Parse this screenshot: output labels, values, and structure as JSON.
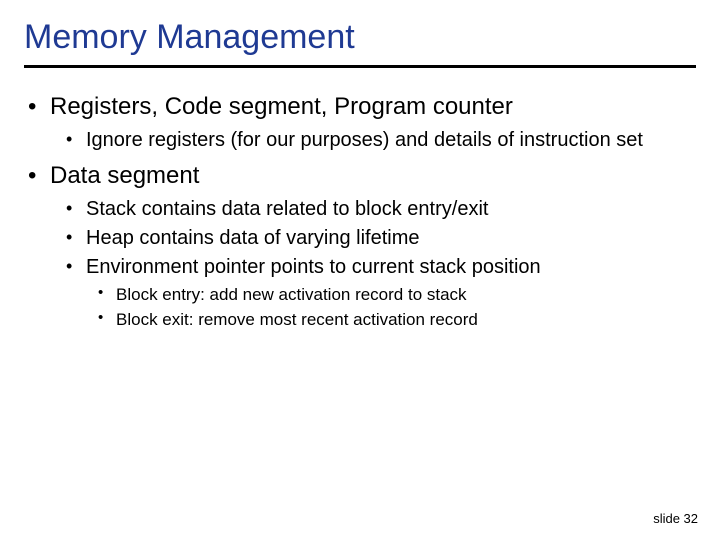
{
  "title": "Memory Management",
  "bullets": {
    "a": {
      "text": "Registers, Code segment, Program counter",
      "sub": {
        "a1": "Ignore registers (for our purposes) and details of instruction set"
      }
    },
    "b": {
      "text": "Data segment",
      "sub": {
        "b1": "Stack contains data related to block entry/exit",
        "b2": "Heap contains data of varying lifetime",
        "b3": "Environment pointer points to current stack position",
        "b3sub": {
          "b3a": "Block entry: add new activation record to stack",
          "b3b": "Block exit: remove most recent activation record"
        }
      }
    }
  },
  "footer": "slide 32"
}
